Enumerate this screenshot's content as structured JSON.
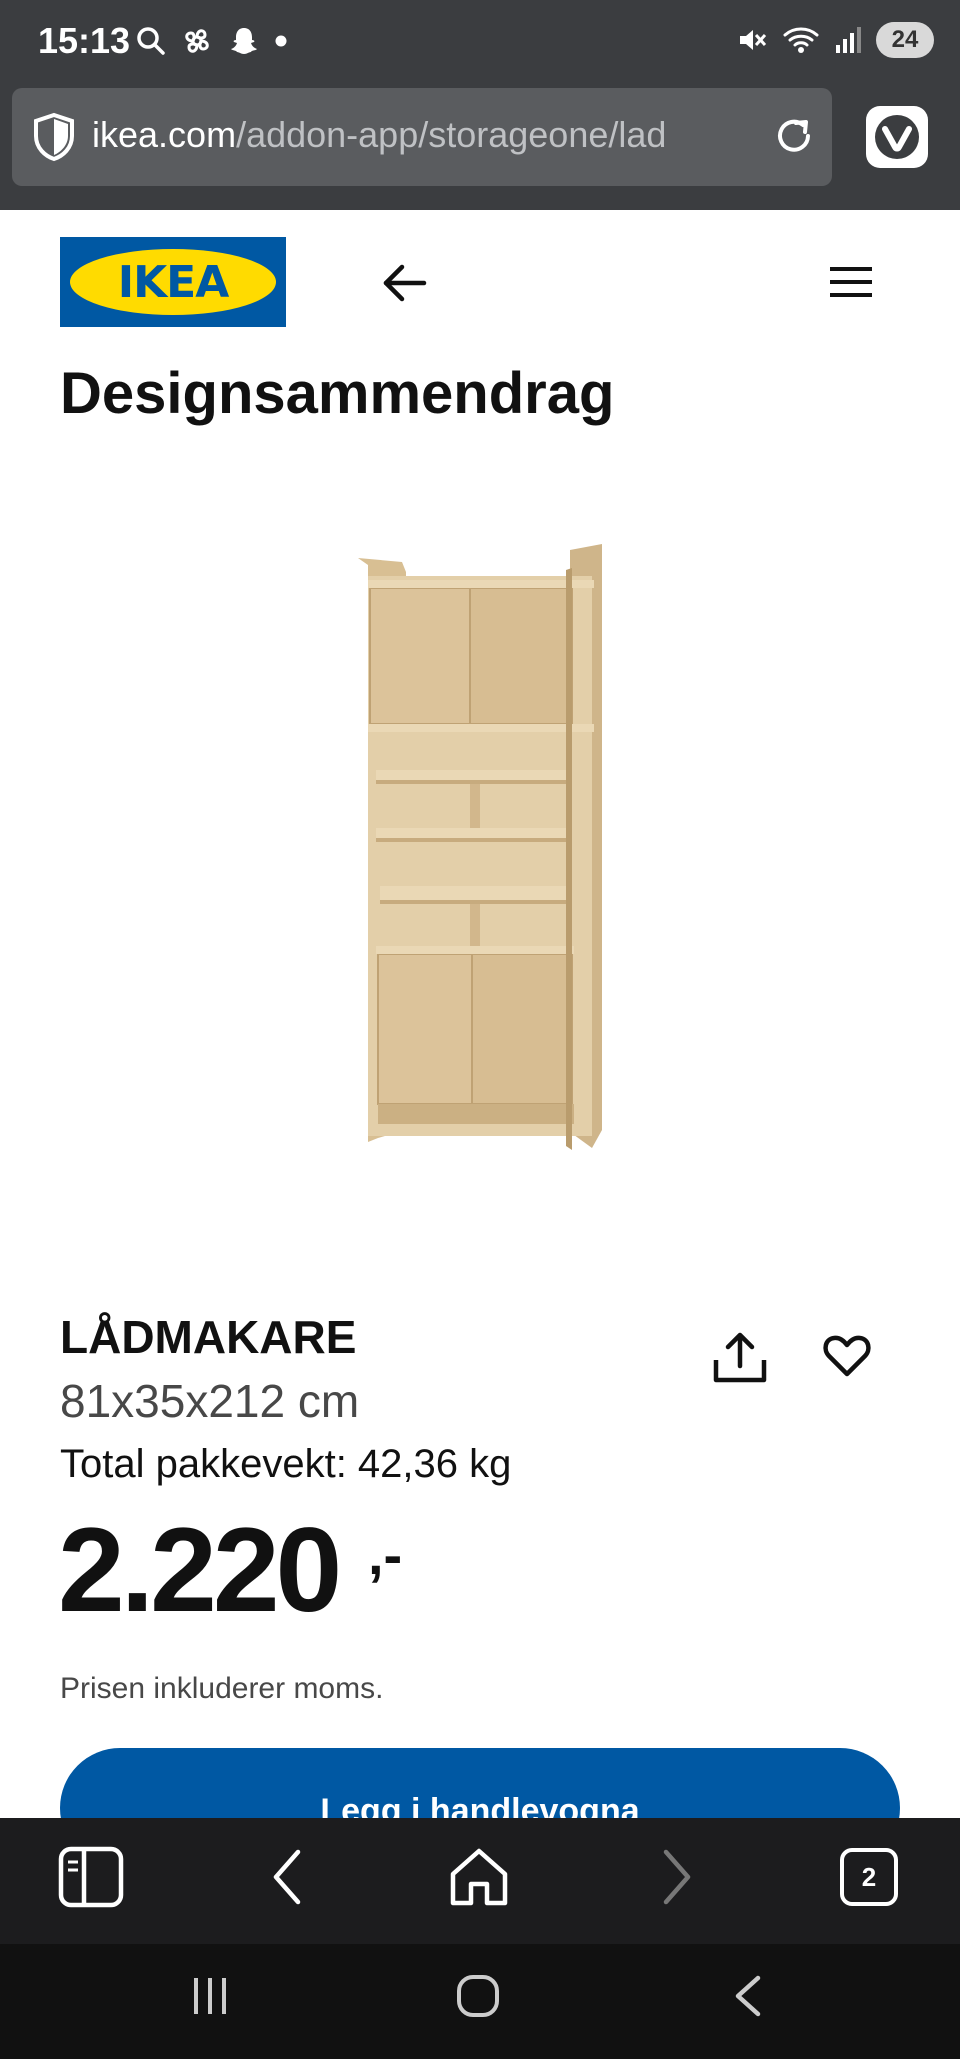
{
  "status_bar": {
    "time": "15:13",
    "battery": "24",
    "left_icons": [
      "search-icon",
      "pinwheel-icon",
      "snapchat-icon",
      "dot-icon"
    ],
    "right_icons": [
      "mute-icon",
      "wifi-icon",
      "signal-icon"
    ]
  },
  "browser": {
    "url_domain": "ikea.com",
    "url_path": "/addon-app/storageone/lad",
    "tab_count": "2"
  },
  "header": {
    "logo_text": "IKEA",
    "page_title": "Designsammendrag"
  },
  "product": {
    "name": "LÅDMAKARE",
    "dimensions": "81x35x212 cm",
    "weight": "Total pakkevekt: 42,36 kg",
    "price": "2.220",
    "price_suffix": ",-",
    "vat_note": "Prisen inkluderer moms.",
    "cart_label": "Legg i handlevogna"
  },
  "colors": {
    "ikea_blue": "#0058a3",
    "ikea_yellow": "#ffdb00",
    "status_bar_bg": "#3b3d40",
    "bottom_bar_bg": "#1c1c1e"
  }
}
